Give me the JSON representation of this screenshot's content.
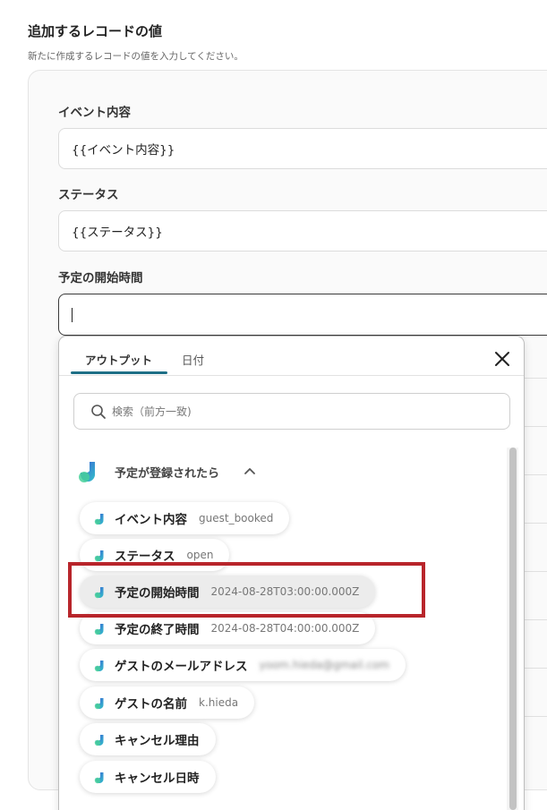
{
  "section": {
    "title": "追加するレコードの値",
    "description": "新たに作成するレコードの値を入力してください。"
  },
  "fields": [
    {
      "label": "イベント内容",
      "value": "{{イベント内容}}"
    },
    {
      "label": "ステータス",
      "value": "{{ステータス}}"
    },
    {
      "label": "予定の開始時間",
      "value": ""
    }
  ],
  "dropdown": {
    "tabs": [
      "アウトプット",
      "日付"
    ],
    "active_tab": "アウトプット",
    "search_placeholder": "検索（前方一致)",
    "group": {
      "label": "予定が登録されたら",
      "expanded": true
    },
    "items": [
      {
        "label": "イベント内容",
        "value": "guest_booked",
        "highlighted": false,
        "blurred": false
      },
      {
        "label": "ステータス",
        "value": "open",
        "highlighted": false,
        "blurred": false
      },
      {
        "label": "予定の開始時間",
        "value": "2024-08-28T03:00:00.000Z",
        "highlighted": true,
        "blurred": false
      },
      {
        "label": "予定の終了時間",
        "value": "2024-08-28T04:00:00.000Z",
        "highlighted": false,
        "blurred": false
      },
      {
        "label": "ゲストのメールアドレス",
        "value": "yoom.hieda@gmail.com",
        "highlighted": false,
        "blurred": true
      },
      {
        "label": "ゲストの名前",
        "value": "k.hieda",
        "highlighted": false,
        "blurred": false
      },
      {
        "label": "キャンセル理由",
        "value": "",
        "highlighted": false,
        "blurred": false
      },
      {
        "label": "キャンセル日時",
        "value": "",
        "highlighted": false,
        "blurred": false
      }
    ]
  },
  "colors": {
    "accent": "#1e6f86",
    "annotation_box": "#b8252b",
    "chip_highlight": "#ececec"
  }
}
